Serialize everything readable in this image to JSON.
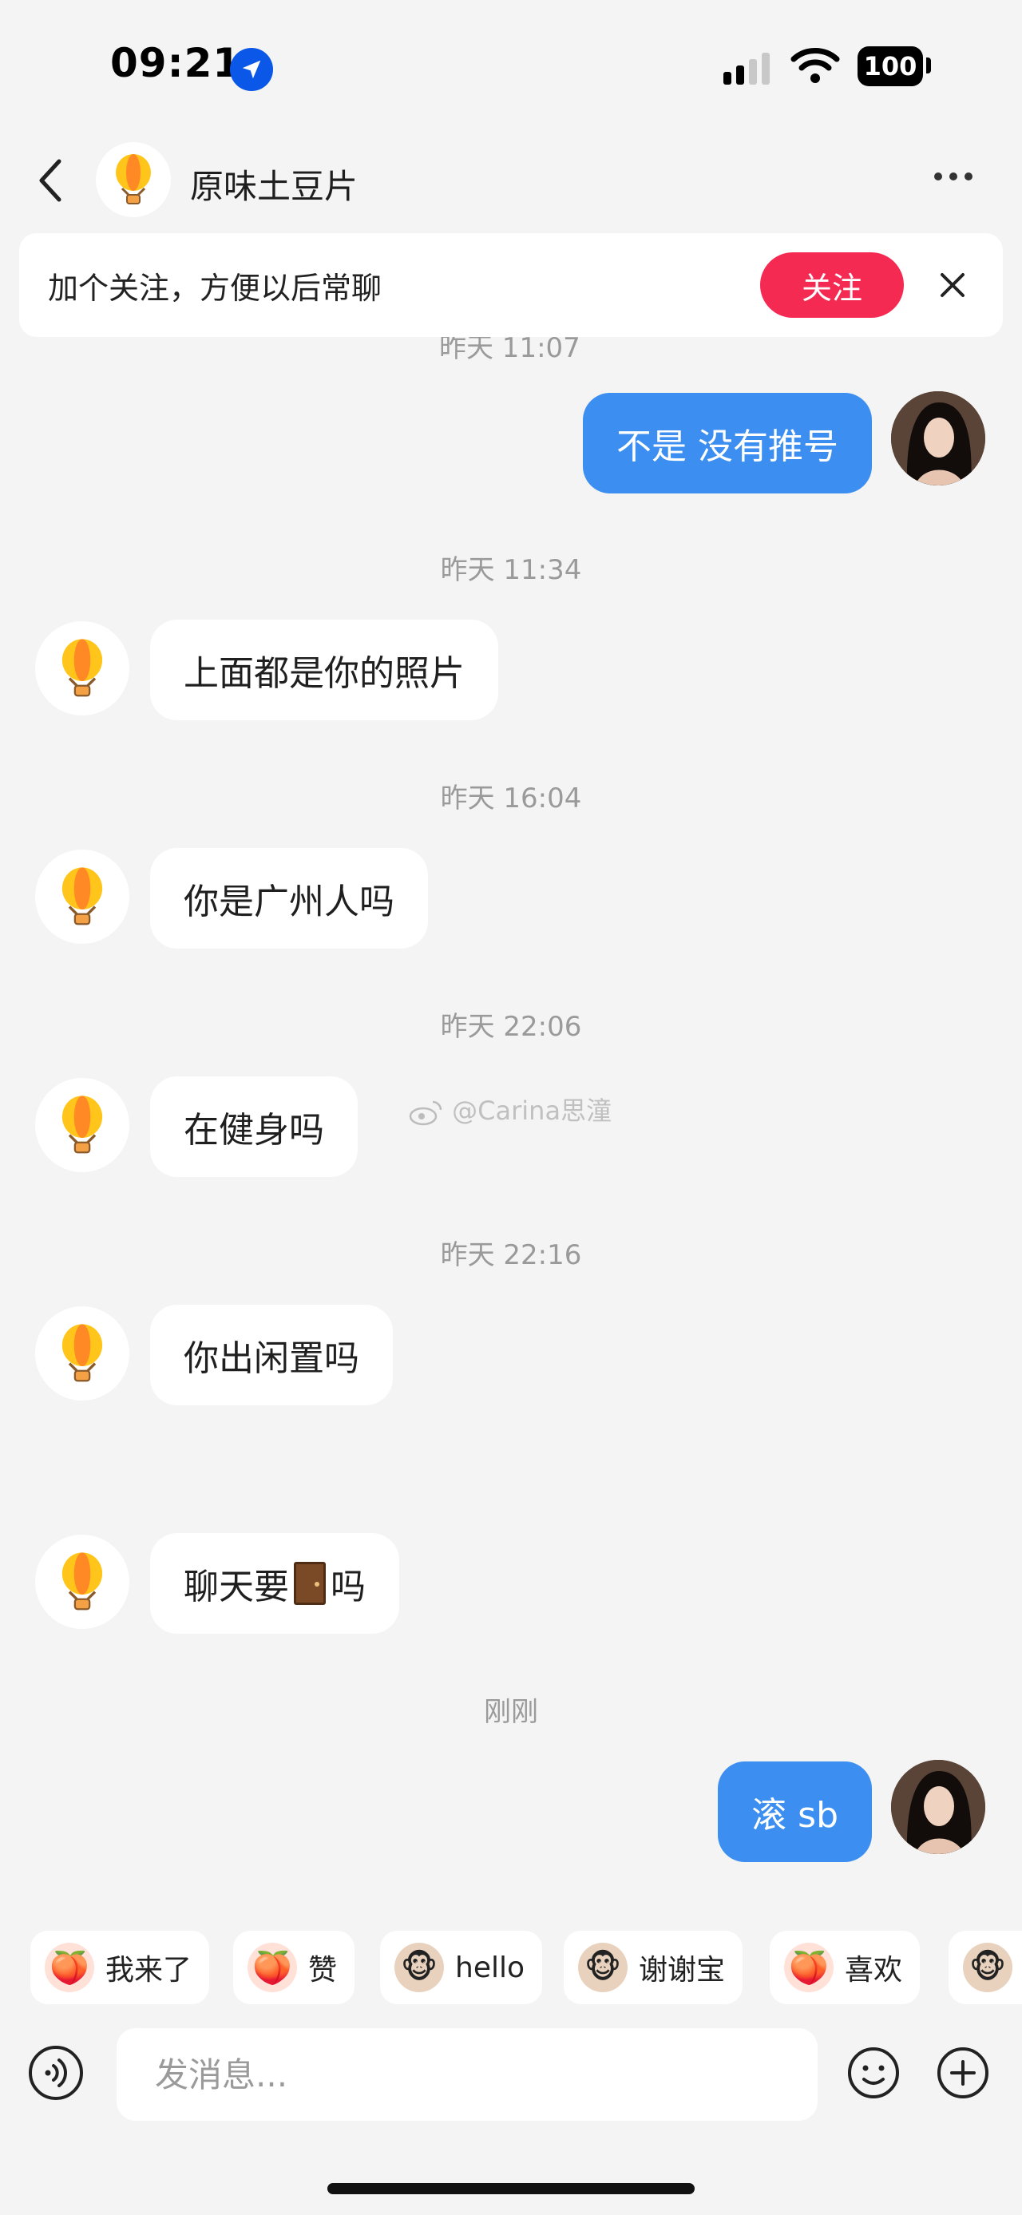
{
  "status_bar": {
    "time": "09:21",
    "battery": "100"
  },
  "header": {
    "contact_name": "原味土豆片"
  },
  "banner": {
    "text": "加个关注，方便以后常聊",
    "follow_label": "关注"
  },
  "cut_timestamp": "昨天 11:07",
  "messages": [
    {
      "from": "me",
      "text": "不是 没有推号"
    },
    {
      "time": "昨天 11:34"
    },
    {
      "from": "them",
      "text": "上面都是你的照片"
    },
    {
      "time": "昨天 16:04"
    },
    {
      "from": "them",
      "text": "你是广州人吗"
    },
    {
      "time": "昨天 22:06"
    },
    {
      "from": "them",
      "text": "在健身吗"
    },
    {
      "time": "昨天 22:16"
    },
    {
      "from": "them",
      "text": "你出闲置吗"
    },
    {
      "from": "them",
      "text_before": "聊天要",
      "emoji": "🚪",
      "text_after": "吗"
    },
    {
      "time": "刚刚"
    },
    {
      "from": "me",
      "text": "滚 sb"
    }
  ],
  "watermark": "@Carina思潼",
  "quick_replies": [
    {
      "label": "我来了",
      "icon": "peach-waving-icon",
      "emoji": "🍑"
    },
    {
      "label": "赞",
      "icon": "peach-thumbs-icon",
      "emoji": "🍑"
    },
    {
      "label": "hello",
      "icon": "monkey-hello-icon",
      "emoji": "🐵"
    },
    {
      "label": "谢谢宝",
      "icon": "monkey-flower-icon",
      "emoji": "🐵"
    },
    {
      "label": "喜欢",
      "icon": "peach-love-icon",
      "emoji": "🍑"
    },
    {
      "label": "",
      "icon": "monkey-partial-icon",
      "emoji": "🐵"
    }
  ],
  "input": {
    "placeholder": "发消息..."
  },
  "colors": {
    "accent_blue": "#3c8ef0",
    "follow_red": "#f52a52",
    "background": "#f4f4f4"
  }
}
